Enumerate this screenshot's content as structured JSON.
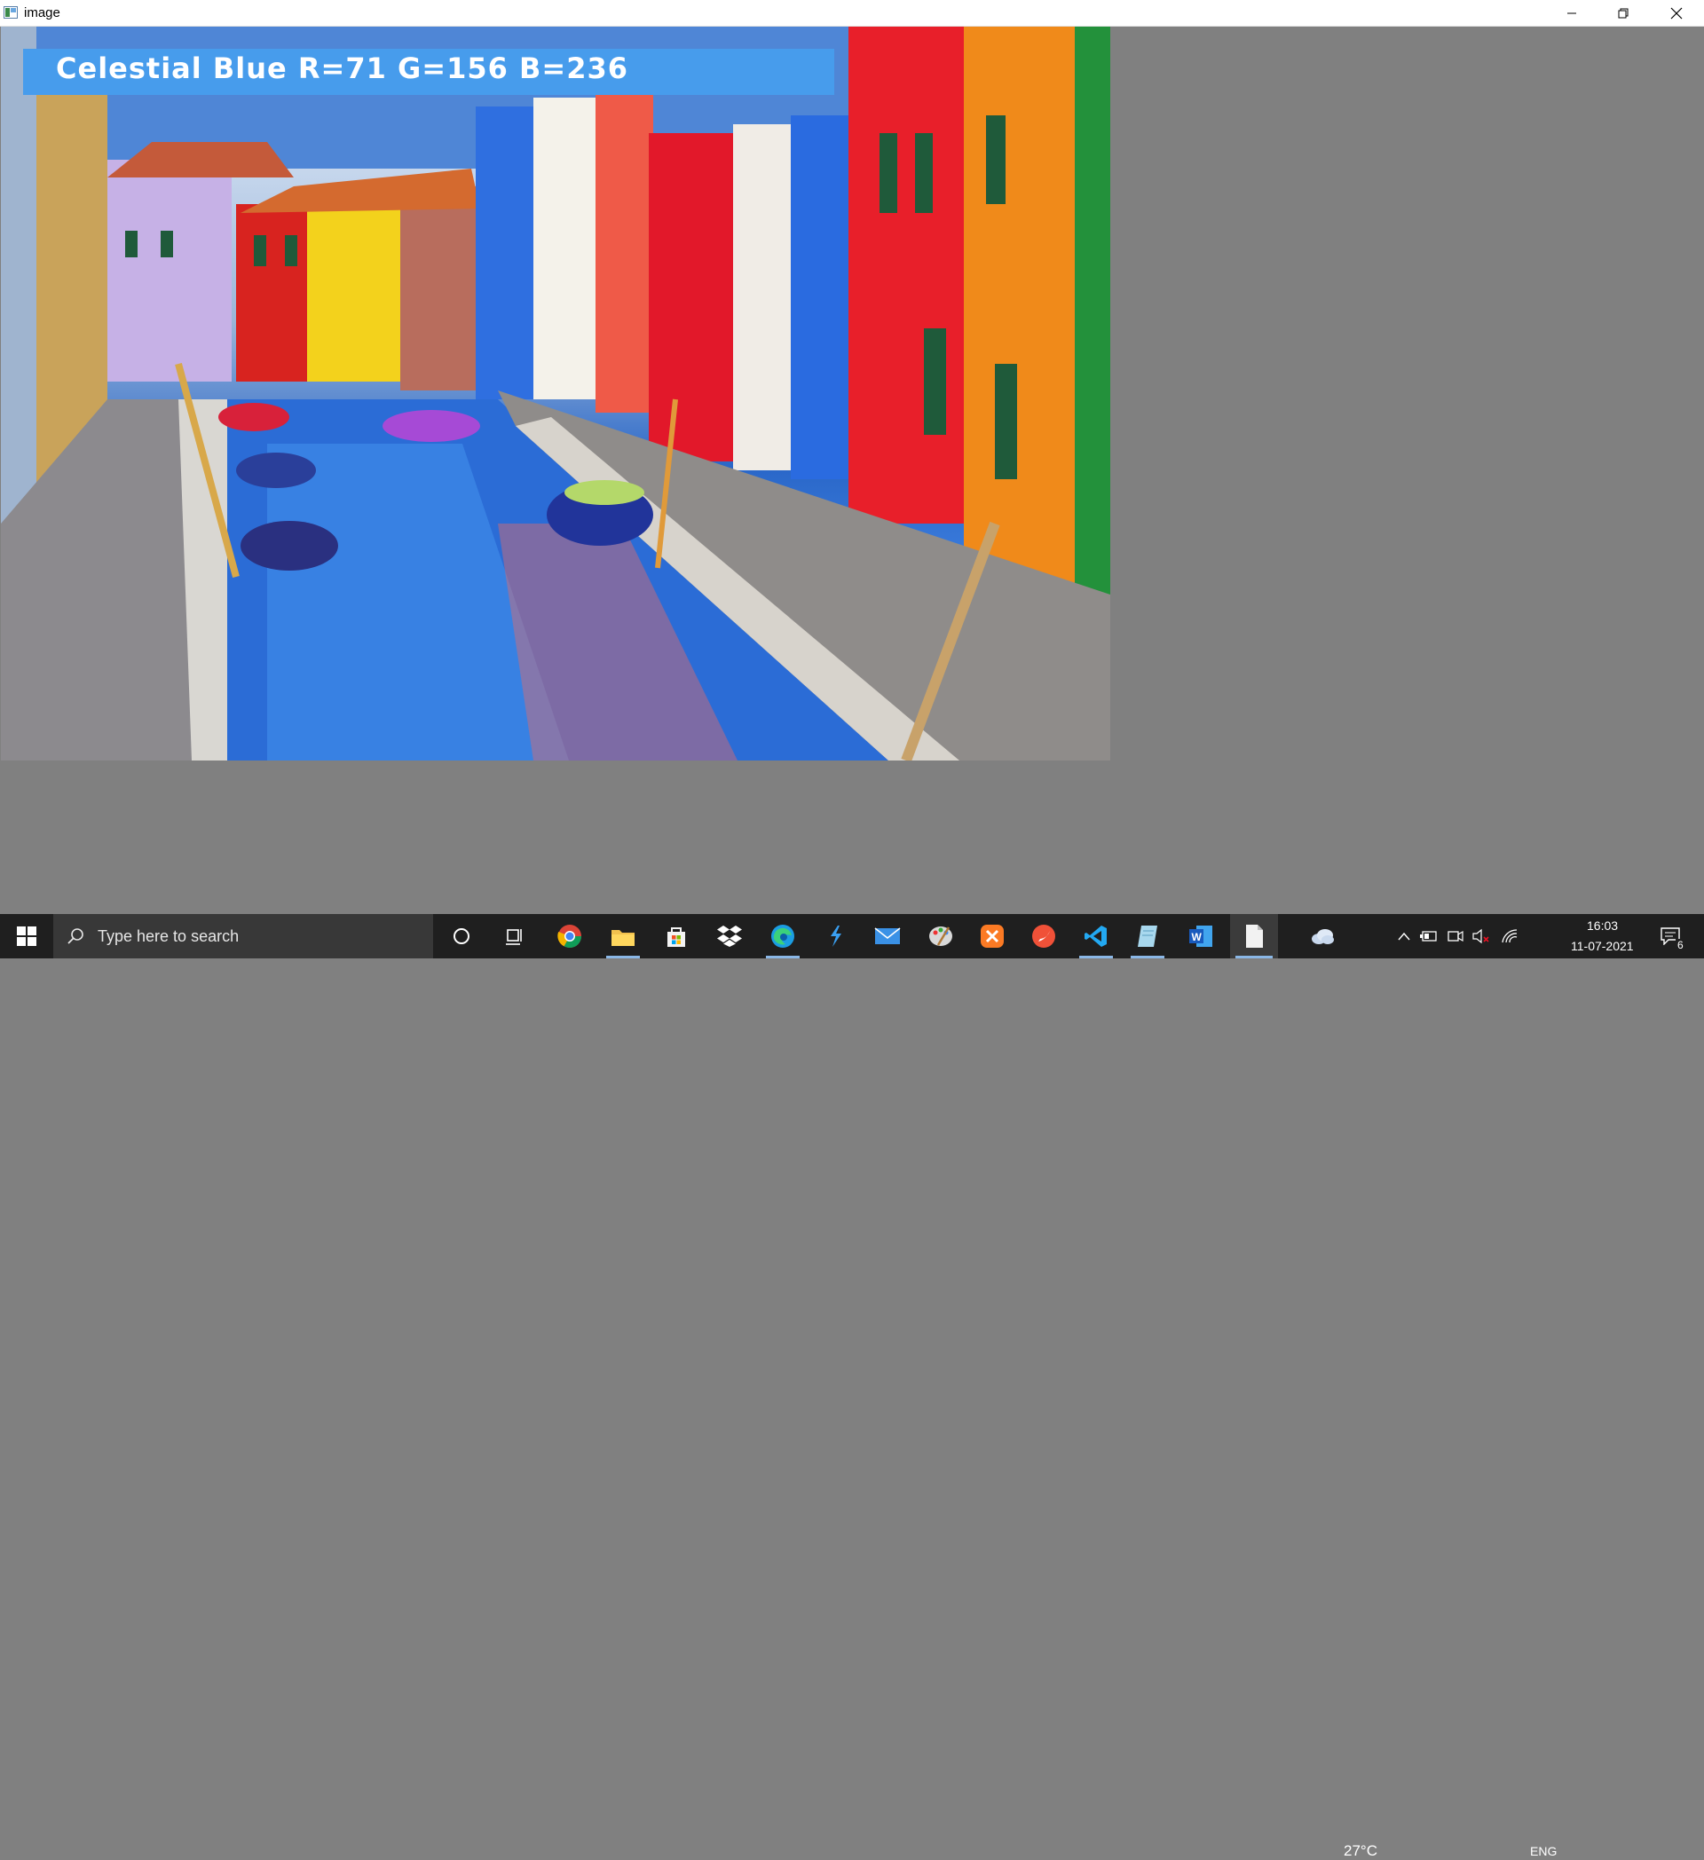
{
  "window": {
    "title": "image",
    "icon": "image-window-icon",
    "controls": [
      "minimize-icon",
      "restore-icon",
      "close-icon"
    ]
  },
  "image_view": {
    "overlay_text": "Celestial Blue R=71 G=156 B=236",
    "overlay_color": "#479cec",
    "background_color": "#808080"
  },
  "taskbar": {
    "search_placeholder": "Type here to search",
    "pinned_apps": [
      "cortana-icon",
      "task-view-icon",
      "chrome-icon",
      "file-explorer-icon",
      "microsoft-store-icon",
      "dropbox-icon",
      "edge-icon",
      "visual-studio-installer-icon",
      "mail-icon",
      "paint-icon",
      "xampp-icon",
      "swift-icon",
      "vscode-icon",
      "notepad-icon",
      "word-icon",
      "image-viewer-icon"
    ],
    "tray": {
      "weather_temp": "27°C",
      "language": "ENG",
      "time": "16:03",
      "date": "11-07-2021",
      "notification_count": "6"
    }
  }
}
